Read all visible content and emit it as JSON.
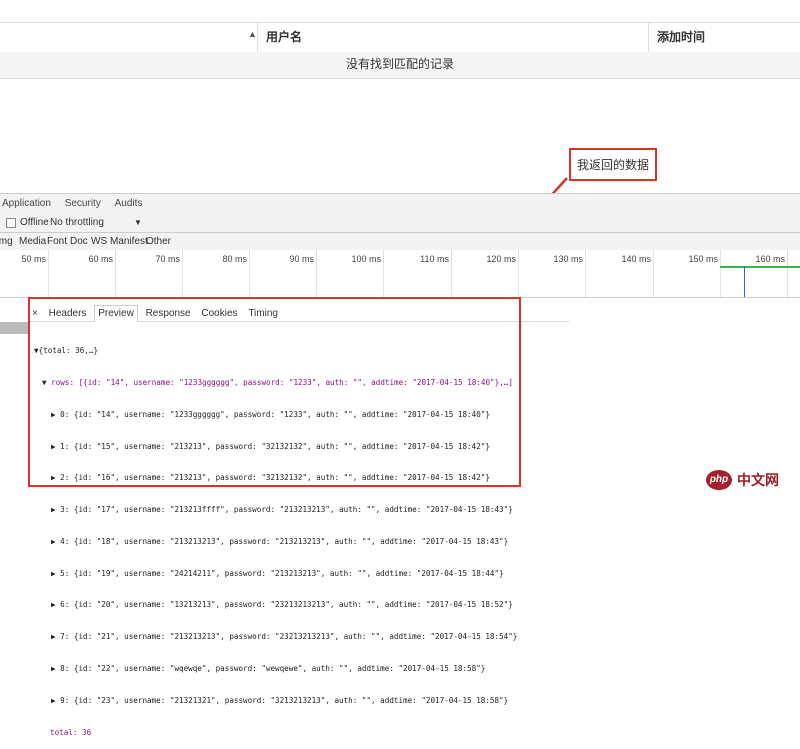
{
  "table": {
    "sort_icon": "sort-up-icon",
    "col_username": "用户名",
    "col_addtime": "添加时间",
    "empty_message": "没有找到匹配的记录"
  },
  "annotation": {
    "label": "我返回的数据",
    "color": "#d9342a"
  },
  "devtools": {
    "tabs": [
      "Application",
      "Security",
      "Audits"
    ],
    "offline_label": "Offline",
    "throttle_value": "No throttling",
    "throttle_arrow": "▼",
    "filters": [
      "Img",
      "Media",
      "Font",
      "Doc",
      "WS",
      "Manifest",
      "Other"
    ],
    "ticks": [
      "50 ms",
      "60 ms",
      "70 ms",
      "80 ms",
      "90 ms",
      "100 ms",
      "110 ms",
      "120 ms",
      "130 ms",
      "140 ms",
      "150 ms",
      "160 ms"
    ]
  },
  "preview": {
    "close": "×",
    "tabs": [
      "Headers",
      "Preview",
      "Response",
      "Cookies",
      "Timing"
    ],
    "active_tab": "Preview",
    "root": "{total: 36,…}",
    "rows_line": "rows: [{id: \"14\", username: \"1233gggggg\", password: \"1233\", auth: \"\", addtime: \"2017-04-15 18:40\"},…]",
    "rows": [
      "0: {id: \"14\", username: \"1233gggggg\", password: \"1233\", auth: \"\", addtime: \"2017-04-15 18:40\"}",
      "1: {id: \"15\", username: \"213213\", password: \"32132132\", auth: \"\", addtime: \"2017-04-15 18:42\"}",
      "2: {id: \"16\", username: \"213213\", password: \"32132132\", auth: \"\", addtime: \"2017-04-15 18:42\"}",
      "3: {id: \"17\", username: \"213213ffff\", password: \"213213213\", auth: \"\", addtime: \"2017-04-15 18:43\"}",
      "4: {id: \"18\", username: \"213213213\", password: \"213213213\", auth: \"\", addtime: \"2017-04-15 18:43\"}",
      "5: {id: \"19\", username: \"24214211\", password: \"213213213\", auth: \"\", addtime: \"2017-04-15 18:44\"}",
      "6: {id: \"20\", username: \"13213213\", password: \"23213213213\", auth: \"\", addtime: \"2017-04-15 18:52\"}",
      "7: {id: \"21\", username: \"213213213\", password: \"23213213213\", auth: \"\", addtime: \"2017-04-15 18:54\"}",
      "8: {id: \"22\", username: \"wqewqe\", password: \"wewqewe\", auth: \"\", addtime: \"2017-04-15 18:58\"}",
      "9: {id: \"23\", username: \"21321321\", password: \"3213213213\", auth: \"\", addtime: \"2017-04-15 18:58\"}"
    ],
    "total_line": "total: 36"
  },
  "watermark": {
    "logo": "php",
    "text": "中文网"
  }
}
